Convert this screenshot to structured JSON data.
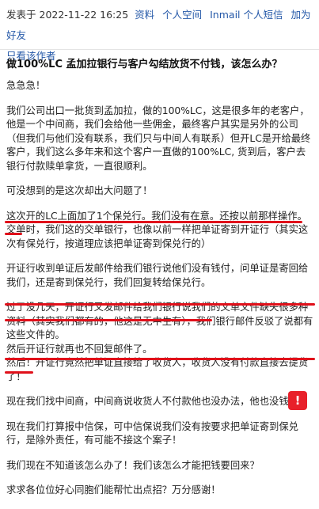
{
  "meta": {
    "posted_label": "发表于",
    "datetime": "2022-11-22 16:25",
    "links": [
      "资料",
      "个人空间",
      "Inmail 个人短信",
      "加为好友"
    ],
    "only_author": "只看该作者"
  },
  "post": {
    "title": "做100%LC 孟加拉银行与客户勾结放货不付钱，该怎么办？",
    "paragraphs": [
      "急急急！",
      "我们公司出口一批货到孟加拉，做的100%LC，这是很多年的老客户，他是一个中间商，我们会给他一些佣金，最终客户其实是另外的公司（但我们与他们没有联系，我们只与中间人有联系）但开LC是开给最终客户，我们这么多年来和这个客户一直做的100%LC, 货到后，客户去银行付款赎单拿货，一直很顺利。",
      "可没想到的是这次却出大问题了！",
      "这次开的LC上面加了1个保兑行。我们没有在意。还按以前那样操作。",
      "交单时，我们这的交单银行，也像以前一样把单证寄到开证行（其实这次有保兑行，按道理应该把单证寄到保兑行的）",
      "开证行收到单证后发邮件给我们银行说他们没有钱付，问单证是寄回给我们，还是寄到保兑行，我们回复转给保兑行。",
      "过了没几天，开证行又发邮件给我们银行说我们的文单文件缺失很多种资料（其实我们都有的，他这是无中生有），我们银行邮件反驳了说都有这些文件的。",
      "然后开证行就再也不回复邮件了。",
      "然后！开证行竟然把单证直接给了收货人，收货人没有付款直接去提货了！",
      "现在我们找中间商，中间商说收货人不付款他也没办法，他也没钱！",
      "现在我们打算报中信保，可中信保说我们没有按要求把单证寄到保兑行，是除外责任，有可能不接这个案子！",
      "我们现在不知道该怎么办了！我们该怎么才能把钱要回来？",
      "求求各位位好心同胞们能帮忙出点招？万分感谢！"
    ]
  },
  "badge": {
    "text": "!"
  },
  "colors": {
    "link": "#2458a8",
    "highlight": "#e0101a"
  }
}
